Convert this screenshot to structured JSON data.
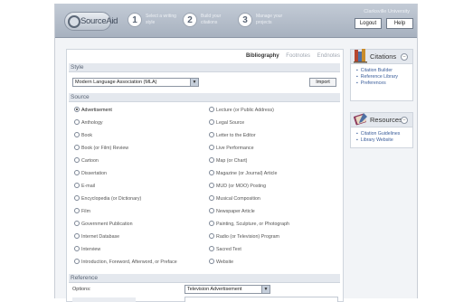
{
  "header": {
    "logo_text": "SourceAid",
    "steps": [
      {
        "num": "1",
        "text": "Select a writing style"
      },
      {
        "num": "2",
        "text": "Build your citations"
      },
      {
        "num": "3",
        "text": "Manage your projects"
      }
    ],
    "institution": "Clarksville University",
    "logout_label": "Logout",
    "help_label": "Help"
  },
  "tabs": {
    "bibliography": "Bibliography",
    "footnotes": "Footnotes",
    "endnotes": "Endnotes"
  },
  "style": {
    "section_label": "Style",
    "selected": "Modern Language Association (MLA)",
    "import_label": "Import"
  },
  "source": {
    "section_label": "Source",
    "left": [
      "Advertisement",
      "Anthology",
      "Book",
      "Book (or Film) Review",
      "Cartoon",
      "Dissertation",
      "E-mail",
      "Encyclopedia (or Dictionary)",
      "Film",
      "Government Publication",
      "Internet Database",
      "Interview",
      "Introduction, Foreword, Afterword, or Preface"
    ],
    "right": [
      "Lecture (or Public Address)",
      "Legal Source",
      "Letter to the Editor",
      "Live Performance",
      "Map (or Chart)",
      "Magazine (or Journal) Article",
      "MUD (or MOO) Posting",
      "Musical Composition",
      "Newspaper Article",
      "Painting, Sculpture, or Photograph",
      "Radio (or Television) Program",
      "Sacred Text",
      "Website"
    ],
    "selected": "Advertisement"
  },
  "reference": {
    "section_label": "Reference",
    "options_label": "Options:",
    "options_value": "Television Advertisement"
  },
  "sidebar": {
    "citations": {
      "title": "Citations",
      "links": [
        "Citation Builder",
        "Reference Library",
        "Preferences"
      ]
    },
    "resources": {
      "title": "Resources",
      "links": [
        "Citation Guidelines",
        "Library Website"
      ]
    }
  }
}
